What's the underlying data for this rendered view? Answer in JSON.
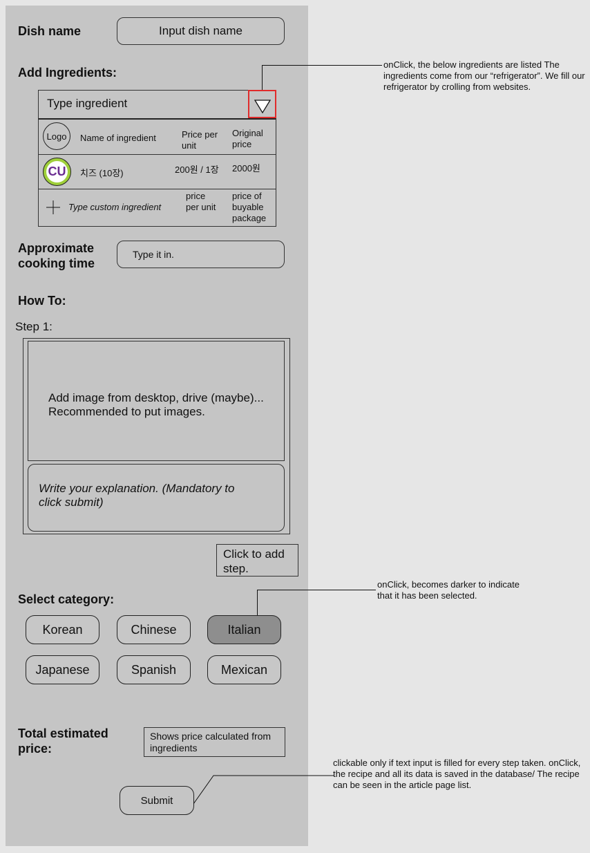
{
  "form": {
    "dish_name_label": "Dish name",
    "dish_name_placeholder": "Input dish name",
    "add_ingredients_label": "Add Ingredients:",
    "ingredient_input_placeholder": "Type ingredient",
    "ingredient_table": {
      "header": {
        "logo": "Logo",
        "name": "Name of ingredient",
        "price_per_unit": "Price per unit",
        "original_price": "Original price"
      },
      "rows": [
        {
          "logo": "CU",
          "name": "치즈 (10장)",
          "price_per_unit": "200원 / 1장",
          "original_price": "2000원"
        }
      ],
      "custom": {
        "name": "Type custom ingredient",
        "price_per_unit": "price per unit",
        "package_price": "price of buyable package"
      }
    },
    "cooking_time_label": "Approximate cooking time",
    "cooking_time_placeholder": "Type it in.",
    "how_to_label": "How To:",
    "step_label": "Step 1:",
    "image_upload_text": "Add image from desktop, drive (maybe)... Recommended to put images.",
    "explanation_placeholder": "Write your explanation. (Mandatory to click submit)",
    "add_step_label": "Click to add step.",
    "select_category_label": "Select category:",
    "categories": [
      {
        "label": "Korean",
        "selected": false
      },
      {
        "label": "Chinese",
        "selected": false
      },
      {
        "label": "Italian",
        "selected": true
      },
      {
        "label": "Japanese",
        "selected": false
      },
      {
        "label": "Spanish",
        "selected": false
      },
      {
        "label": "Mexican",
        "selected": false
      }
    ],
    "total_price_label": "Total estimated price:",
    "total_price_text": "Shows price calculated from ingredients",
    "submit_label": "Submit"
  },
  "annotations": {
    "dropdown_note": "onClick, the below ingredients are listed The ingredients come from our “refrigerator”. We fill our refrigerator by crolling from websites.",
    "category_note": "onClick, becomes darker to indicate that it has been selected.",
    "submit_note": "clickable only if text input is filled for every step taken. onClick, the recipe and all its data is saved in the database/ The recipe can be seen in the article page list."
  },
  "colors": {
    "panel": "#c5c5c5",
    "background": "#e6e6e6",
    "highlight": "#e02b2b",
    "selected": "#8e8e8e",
    "cu_purple": "#6a2c91",
    "cu_green": "#9fcf3a"
  },
  "icons": [
    "dropdown-triangle-icon",
    "logo-placeholder-icon",
    "cu-logo-icon",
    "plus-icon"
  ]
}
